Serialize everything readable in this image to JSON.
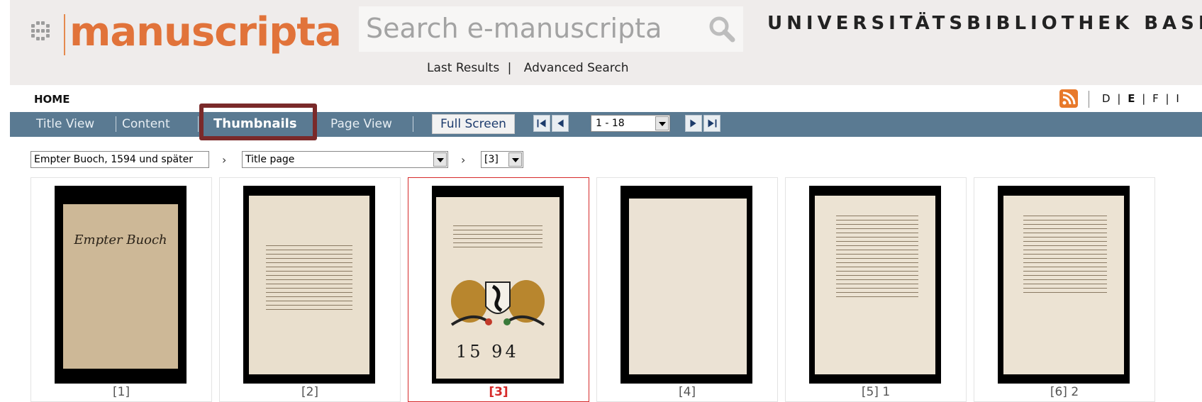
{
  "header": {
    "logo_text": "manuscripta",
    "search_placeholder": "Search e-manuscripta",
    "institution": "UNIVERSITÄTSBIBLIOTHEK BASEL",
    "last_results": "Last Results",
    "link_separator": "|",
    "advanced_search": "Advanced Search"
  },
  "breadcrumb": {
    "home": "HOME"
  },
  "languages": {
    "d": "D",
    "e": "E",
    "f": "F",
    "i": "I",
    "separator": "|",
    "active": "E"
  },
  "nav": {
    "title_view": "Title View",
    "content": "Content",
    "thumbnails": "Thumbnails",
    "page_view": "Page View",
    "full_screen": "Full Screen",
    "range": "1 - 18"
  },
  "selectors": {
    "arrow": "›",
    "document": "Empter Buoch, 1594 und später",
    "section": "Title page",
    "page": "[3]"
  },
  "thumbnails": [
    {
      "caption": "[1]",
      "selected": false
    },
    {
      "caption": "[2]",
      "selected": false
    },
    {
      "caption": "[3]",
      "selected": true
    },
    {
      "caption": "[4]",
      "selected": false
    },
    {
      "caption": "[5] 1",
      "selected": false
    },
    {
      "caption": "[6] 2",
      "selected": false
    }
  ],
  "cover_title": "Empter Buoch",
  "title_page_year": "15 94",
  "colors": {
    "logo_orange": "#e1733a",
    "nav_bar": "#5a7a92",
    "active_tab_outline": "#7a2a2a",
    "selected_red": "#d62a2a",
    "rss_orange": "#e8792a"
  },
  "icons": {
    "search": "search-icon",
    "rss": "rss-icon",
    "first": "first-page-icon",
    "prev": "previous-page-icon",
    "next": "next-page-icon",
    "last": "last-page-icon"
  }
}
